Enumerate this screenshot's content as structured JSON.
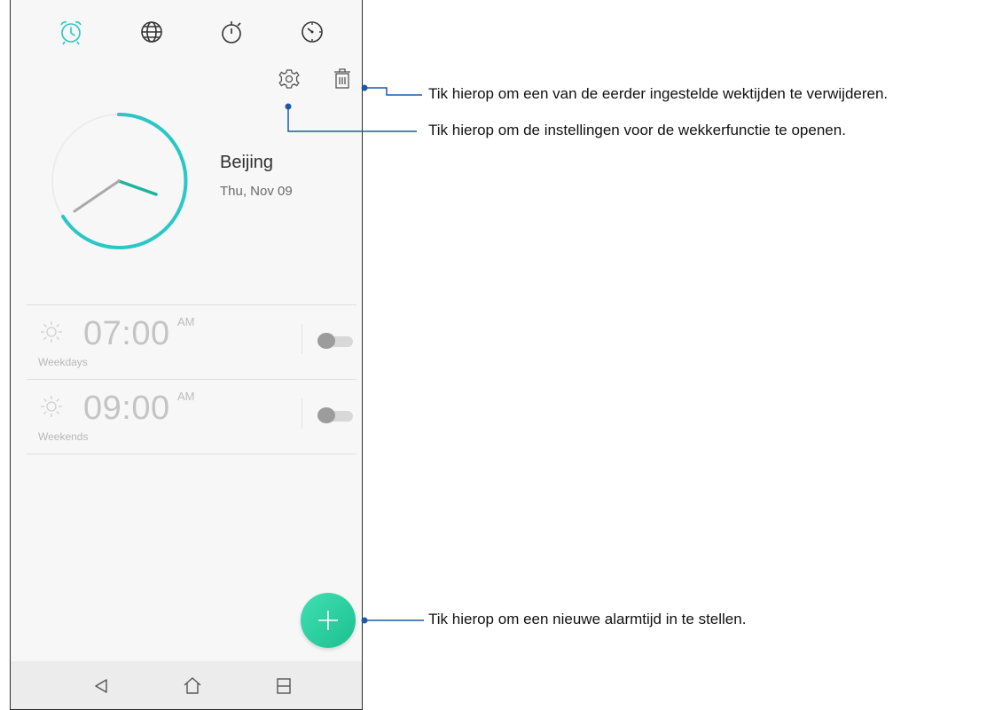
{
  "colors": {
    "accent": "#2bc7c6",
    "accent_dark": "#1d9fb8",
    "fab": "#25cc9c"
  },
  "tabs": [
    {
      "icon": "alarm-clock-icon",
      "active": true
    },
    {
      "icon": "globe-icon",
      "active": false
    },
    {
      "icon": "stopwatch-icon",
      "active": false
    },
    {
      "icon": "timer-icon",
      "active": false
    }
  ],
  "clock": {
    "city": "Beijing",
    "date": "Thu, Nov 09"
  },
  "alarms": [
    {
      "time": "07:00",
      "ampm": "AM",
      "label": "Weekdays",
      "enabled": false,
      "icon": "sun-icon"
    },
    {
      "time": "09:00",
      "ampm": "AM",
      "label": "Weekends",
      "enabled": false,
      "icon": "sun-icon"
    }
  ],
  "navbar": {
    "back_icon": "back-icon",
    "home_icon": "home-icon",
    "recents_icon": "recents-icon"
  },
  "callouts": {
    "delete": "Tik hierop om een van de eerder ingestelde wektijden te verwijderen.",
    "settings": "Tik hierop om de instellingen voor de wekkerfunctie te openen.",
    "add": "Tik hierop om een nieuwe alarmtijd in te stellen."
  }
}
